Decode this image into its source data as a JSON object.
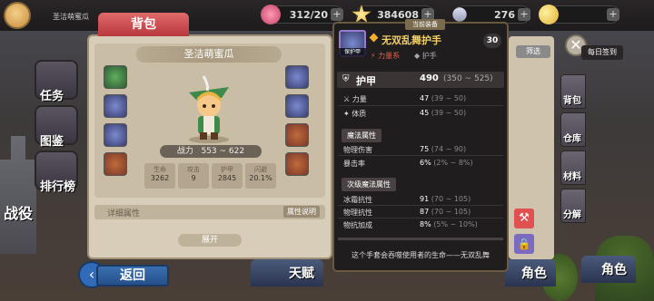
{
  "topbar": {
    "player_name": "圣洁萌蜜瓜",
    "resources": [
      {
        "icon": "heart-gem-icon",
        "value": "312/20",
        "color": "#e05a7a"
      },
      {
        "icon": "star-icon",
        "value": "384608",
        "color": "#f4c040"
      },
      {
        "icon": "diamond-icon",
        "value": "276",
        "color": "#bfc4d0"
      },
      {
        "icon": "moon-icon",
        "value": "",
        "color": "#f4d060"
      }
    ],
    "plus": "+"
  },
  "bag": {
    "title": "背包",
    "hero_name": "圣洁萌蜜瓜",
    "power_label": "战力",
    "power_value": "553 ~ 622",
    "stats": [
      {
        "label": "生命",
        "value": "3262"
      },
      {
        "label": "攻击",
        "value": "9"
      },
      {
        "label": "护甲",
        "value": "2845"
      },
      {
        "label": "闪避",
        "value": "20.1%"
      }
    ],
    "detail_label": "详细属性",
    "attr_note": "属性说明",
    "expand_label": "展开"
  },
  "left_nav": [
    {
      "label": "任务"
    },
    {
      "label": "图鉴"
    },
    {
      "label": "排行榜"
    }
  ],
  "zhanyi": "战役",
  "back_label": "返回",
  "tooltip": {
    "header": "当前装备",
    "item_name": "无双乱舞护手",
    "item_level": "30",
    "item_type_badge": "保护甲",
    "category1": "力量系",
    "category2": "护手",
    "main_stat_label": "护甲",
    "main_stat_value": "490",
    "main_stat_range": "(350 ~ 525)",
    "sub_stats": [
      {
        "label": "力量",
        "value": "47",
        "range": "(39 ~ 50)"
      },
      {
        "label": "体质",
        "value": "45",
        "range": "(39 ~ 50)"
      }
    ],
    "magic_header": "魔法属性",
    "magic_stats": [
      {
        "label": "物理伤害",
        "value": "75",
        "range": "(74 ~ 90)"
      },
      {
        "label": "暴击率",
        "value": "6%",
        "range": "(2% ~ 8%)"
      }
    ],
    "secondary_header": "次级魔法属性",
    "secondary_stats": [
      {
        "label": "冰霜抗性",
        "value": "91",
        "range": "(70 ~ 105)"
      },
      {
        "label": "物理抗性",
        "value": "87",
        "range": "(70 ~ 105)"
      },
      {
        "label": "物抗加成",
        "value": "8%",
        "range": "(5% ~ 10%)"
      }
    ],
    "footer": "这个手套会吞噬使用者的生命——无双乱舞"
  },
  "right": {
    "filter_label": "筛选",
    "daily_label": "每日签到",
    "tabs": [
      "背包",
      "仓库",
      "材料",
      "分解"
    ],
    "bottom_tabs": [
      "天赋",
      "角色",
      "角色"
    ]
  },
  "colors": {
    "accent": "#f4d060",
    "tab_red": "#c8454a",
    "equip_red": "#e05050",
    "lock_purple": "#7a6ac0"
  }
}
